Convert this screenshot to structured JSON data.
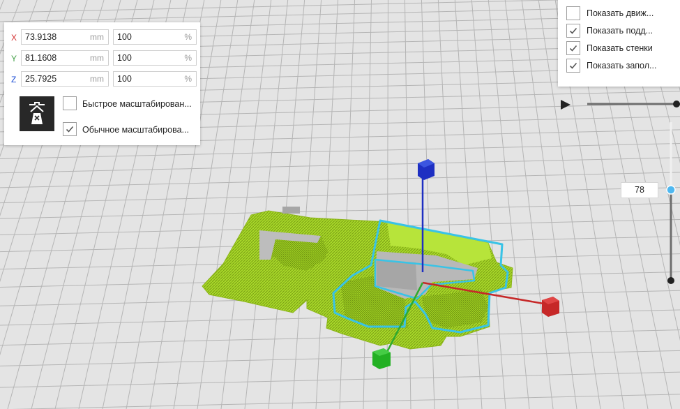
{
  "scale": {
    "x": {
      "axis": "X",
      "value": "73.9138",
      "unit": "mm",
      "percent": "100",
      "percent_unit": "%",
      "color": "#d32f2f"
    },
    "y": {
      "axis": "Y",
      "value": "81.1608",
      "unit": "mm",
      "percent": "100",
      "percent_unit": "%",
      "color": "#43a047"
    },
    "z": {
      "axis": "Z",
      "value": "25.7925",
      "unit": "mm",
      "percent": "100",
      "percent_unit": "%",
      "color": "#1e4fd6"
    },
    "quick_scale_label": "Быстрое масштабирован...",
    "quick_scale_checked": false,
    "uniform_scale_label": "Обычное масштабирова...",
    "uniform_scale_checked": true,
    "tool_icon": "uniform-scale-icon"
  },
  "view_options": {
    "items": [
      {
        "label": "Показать движ...",
        "checked": false
      },
      {
        "label": "Показать подд...",
        "checked": true
      },
      {
        "label": "Показать стенки",
        "checked": true
      },
      {
        "label": "Показать запол...",
        "checked": true
      }
    ]
  },
  "layer_slider": {
    "value": "78"
  },
  "colors": {
    "model": "#a8d824",
    "selection_outline": "#39c3e6",
    "gizmo_x": "#c62828",
    "gizmo_y": "#2eaa2e",
    "gizmo_z": "#1e2fc2",
    "slider_handle": "#4fb8f0"
  }
}
